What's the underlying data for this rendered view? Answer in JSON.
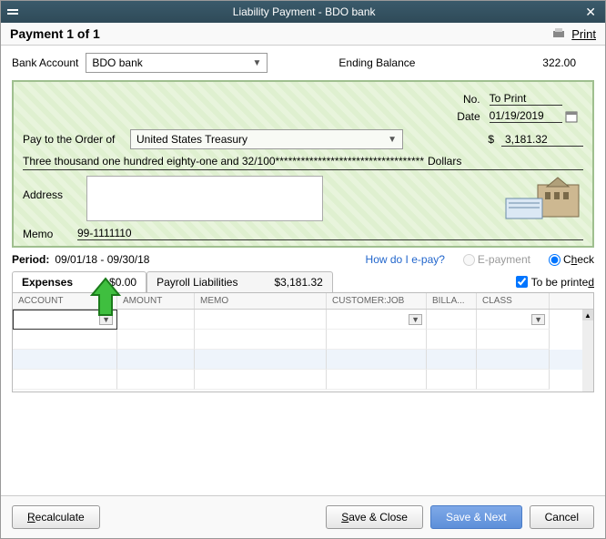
{
  "window": {
    "title": "Liability Payment - BDO bank"
  },
  "header": {
    "payment_text": "Payment 1 of 1",
    "print": "Print"
  },
  "bankrow": {
    "label": "Bank Account",
    "bank": "BDO bank",
    "ending_label": "Ending Balance",
    "ending_value": "322.00"
  },
  "check": {
    "no_label": "No.",
    "no_value": "To Print",
    "date_label": "Date",
    "date_value": "01/19/2019",
    "pay_label": "Pay to the Order of",
    "payee": "United States Treasury",
    "currency": "$",
    "amount": "3,181.32",
    "amount_words": "Three thousand one hundred eighty-one and 32/100***********************************",
    "dollars": "Dollars",
    "address_label": "Address",
    "memo_label": "Memo",
    "memo_value": "99-1111110"
  },
  "period": {
    "label": "Period:",
    "value": "09/01/18 - 09/30/18",
    "epay_link": "How do I e-pay?",
    "epayment": "E-payment",
    "check": "Check"
  },
  "tabs": {
    "expenses_label": "Expenses",
    "expenses_amt": "$0.00",
    "payroll_label": "Payroll Liabilities",
    "payroll_amt": "$3,181.32",
    "to_be_printed": "To be printed"
  },
  "grid": {
    "cols": {
      "account": "ACCOUNT",
      "amount": "AMOUNT",
      "memo": "MEMO",
      "customer": "CUSTOMER:JOB",
      "billa": "BILLA...",
      "class": "CLASS"
    }
  },
  "footer": {
    "recalc": "Recalculate",
    "save_close": "Save & Close",
    "save_next": "Save & Next",
    "cancel": "Cancel"
  }
}
